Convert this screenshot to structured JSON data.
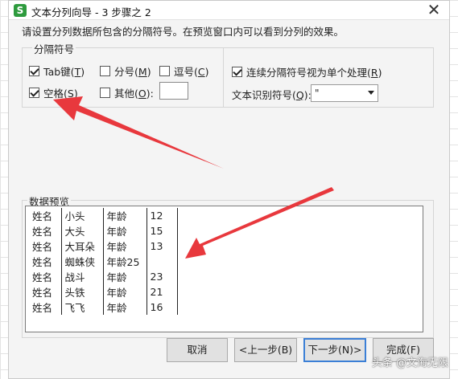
{
  "window": {
    "title": "文本分列向导 - 3 步骤之 2",
    "app_icon_letter": "S",
    "close_glyph": "✕"
  },
  "instruction": "请设置分列数据所包含的分隔符号。在预览窗口内可以看到分列的效果。",
  "delimiters": {
    "group_title": "分隔符号",
    "tab": {
      "label": "Tab键",
      "key": "T",
      "checked": true
    },
    "semicolon": {
      "label": "分号",
      "key": "M",
      "checked": false
    },
    "comma": {
      "label": "逗号",
      "key": "C",
      "checked": false
    },
    "space": {
      "label": "空格",
      "key": "S",
      "checked": true
    },
    "other": {
      "label": "其他",
      "key": "O",
      "checked": false,
      "value": ""
    }
  },
  "options": {
    "consecutive": {
      "label": "连续分隔符号视为单个处理",
      "key": "R",
      "checked": true
    },
    "qualifier_label": "文本识别符号",
    "qualifier_key": "Q",
    "qualifier_value": "\""
  },
  "preview": {
    "title": "数据预览",
    "rows": [
      [
        "姓名",
        "小头",
        "年龄",
        "12"
      ],
      [
        "姓名",
        "大头",
        "年龄",
        "15"
      ],
      [
        "姓名",
        "大耳朵",
        "年龄",
        "13"
      ],
      [
        "姓名",
        "蜘蛛侠",
        "年龄25",
        ""
      ],
      [
        "姓名",
        "战斗",
        "年龄",
        "23"
      ],
      [
        "姓名",
        "头铁",
        "年龄",
        "21"
      ],
      [
        "姓名",
        "飞飞",
        "年龄",
        "16"
      ]
    ]
  },
  "buttons": {
    "cancel": "取消",
    "back": "<上一步(B)",
    "next": "下一步(N)>",
    "finish": "完成(F)"
  },
  "annotation_color": "#e8383d",
  "watermark": "头条 @文海无限"
}
